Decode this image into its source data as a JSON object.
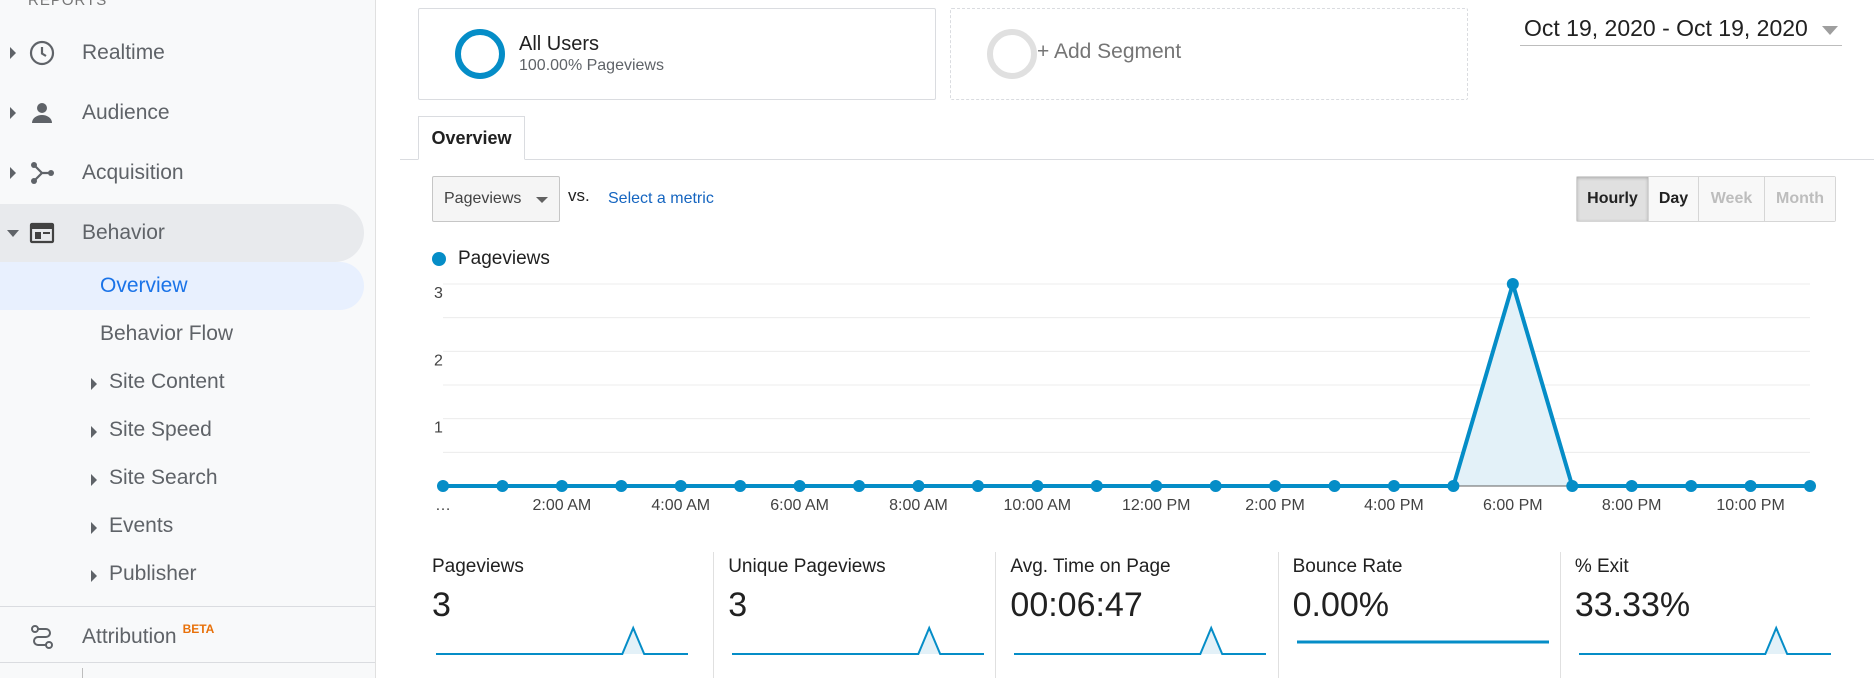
{
  "sidebar": {
    "header": "REPORTS",
    "items": [
      {
        "label": "Realtime",
        "icon": "clock-icon"
      },
      {
        "label": "Audience",
        "icon": "person-icon"
      },
      {
        "label": "Acquisition",
        "icon": "acquisition-icon"
      },
      {
        "label": "Behavior",
        "icon": "behavior-icon",
        "expanded": true
      }
    ],
    "behavior_sub": [
      {
        "label": "Overview",
        "selected": true
      },
      {
        "label": "Behavior Flow"
      },
      {
        "label": "Site Content",
        "expandable": true
      },
      {
        "label": "Site Speed",
        "expandable": true
      },
      {
        "label": "Site Search",
        "expandable": true
      },
      {
        "label": "Events",
        "expandable": true
      },
      {
        "label": "Publisher",
        "expandable": true
      }
    ],
    "attribution": {
      "label": "Attribution",
      "badge": "BETA",
      "icon": "attribution-icon"
    }
  },
  "segments": {
    "all_users": {
      "title": "All Users",
      "subtitle": "100.00% Pageviews"
    },
    "add_segment": "+ Add Segment"
  },
  "date_range": "Oct 19, 2020 - Oct 19, 2020",
  "tabs": [
    {
      "label": "Overview",
      "active": true
    }
  ],
  "controls": {
    "metric_select": "Pageviews",
    "vs": "vs.",
    "select_metric": "Select a metric",
    "granularity": [
      {
        "label": "Hourly",
        "state": "active"
      },
      {
        "label": "Day",
        "state": "enabled"
      },
      {
        "label": "Week",
        "state": "disabled"
      },
      {
        "label": "Month",
        "state": "disabled"
      }
    ]
  },
  "chart_data": {
    "type": "area",
    "legend": [
      "Pageviews"
    ],
    "x_tick_labels": [
      "…",
      "2:00 AM",
      "4:00 AM",
      "6:00 AM",
      "8:00 AM",
      "10:00 AM",
      "12:00 PM",
      "2:00 PM",
      "4:00 PM",
      "6:00 PM",
      "8:00 PM",
      "10:00 PM"
    ],
    "series": [
      {
        "name": "Pageviews",
        "values": [
          0,
          0,
          0,
          0,
          0,
          0,
          0,
          0,
          0,
          0,
          0,
          0,
          0,
          0,
          0,
          0,
          0,
          0,
          3,
          0,
          0,
          0,
          0,
          0
        ],
        "color": "#058dc7"
      }
    ],
    "y_ticks": [
      1,
      2,
      3
    ],
    "ylim": [
      0,
      3
    ],
    "grid": true
  },
  "scorecards": [
    {
      "label": "Pageviews",
      "value": "3",
      "spark": [
        0,
        0,
        0,
        0,
        0,
        0,
        0,
        0,
        0,
        0,
        0,
        0,
        0,
        0,
        0,
        0,
        0,
        0,
        3,
        0,
        0,
        0,
        0,
        0
      ]
    },
    {
      "label": "Unique Pageviews",
      "value": "3",
      "spark": [
        0,
        0,
        0,
        0,
        0,
        0,
        0,
        0,
        0,
        0,
        0,
        0,
        0,
        0,
        0,
        0,
        0,
        0,
        3,
        0,
        0,
        0,
        0,
        0
      ]
    },
    {
      "label": "Avg. Time on Page",
      "value": "00:06:47",
      "spark": [
        0,
        0,
        0,
        0,
        0,
        0,
        0,
        0,
        0,
        0,
        0,
        0,
        0,
        0,
        0,
        0,
        0,
        0,
        3,
        0,
        0,
        0,
        0,
        0
      ]
    },
    {
      "label": "Bounce Rate",
      "value": "0.00%",
      "spark": [
        0,
        0,
        0,
        0,
        0,
        0,
        0,
        0,
        0,
        0,
        0,
        0,
        0,
        0,
        0,
        0,
        0,
        0,
        0,
        0,
        0,
        0,
        0,
        0
      ]
    },
    {
      "label": "% Exit",
      "value": "33.33%",
      "spark": [
        0,
        0,
        0,
        0,
        0,
        0,
        0,
        0,
        0,
        0,
        0,
        0,
        0,
        0,
        0,
        0,
        0,
        0,
        3,
        0,
        0,
        0,
        0,
        0
      ]
    }
  ]
}
